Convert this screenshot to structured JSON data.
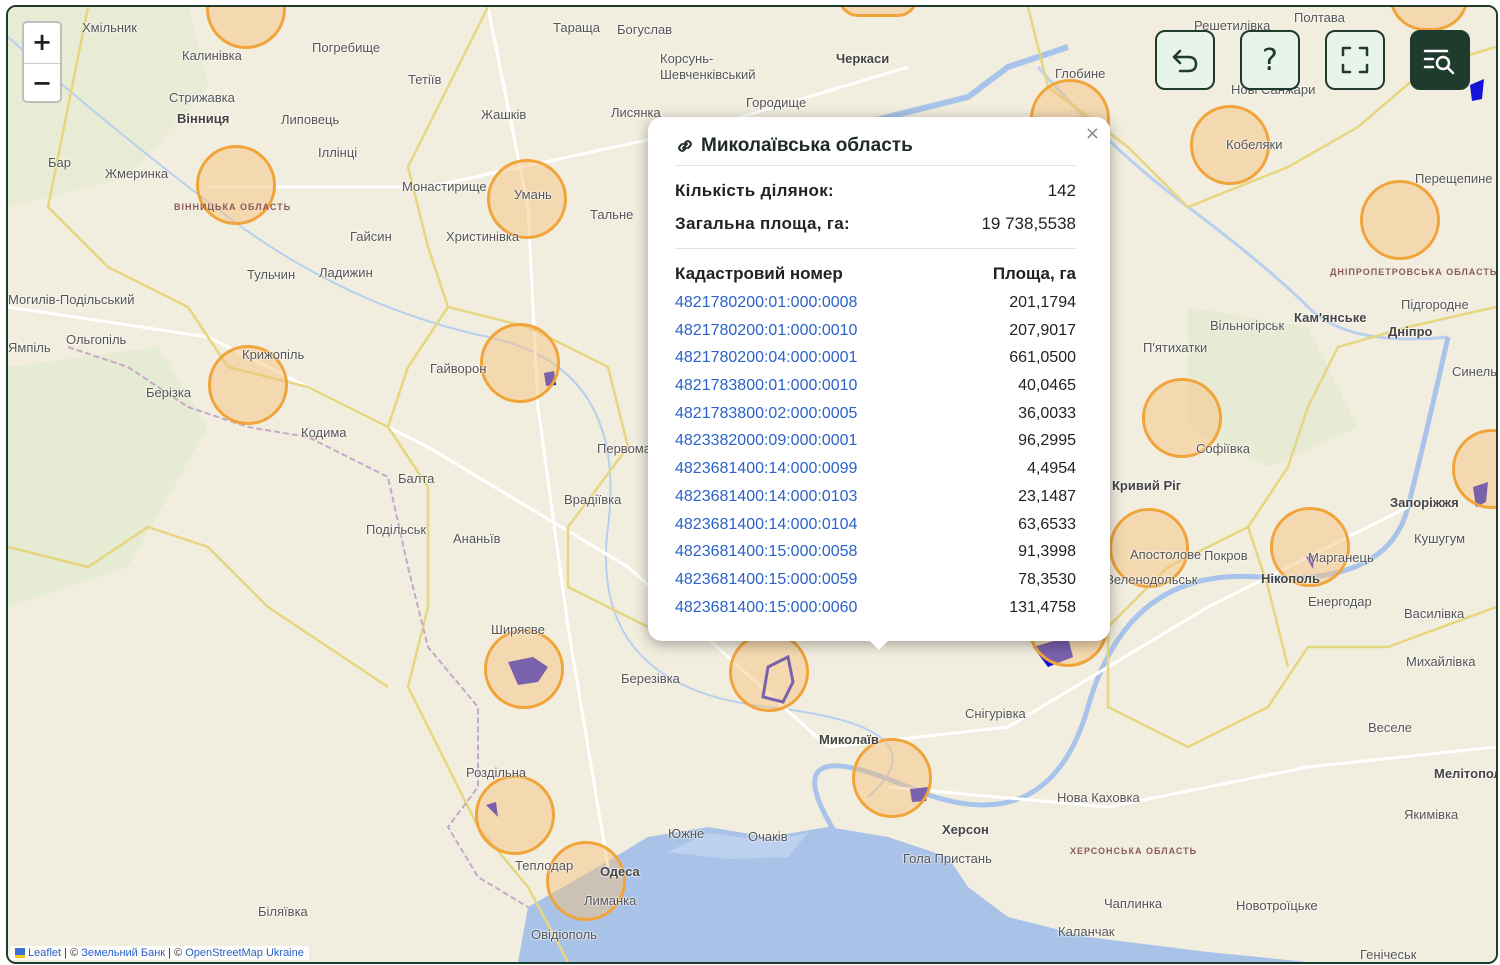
{
  "map": {
    "region_labels": [
      "ВІННИЦЬКА ОБЛАСТЬ",
      "ДНІПРОПЕТРОВСЬКА ОБЛАСТЬ",
      "ХЕРСОНСЬКА ОБЛАСТЬ"
    ],
    "cities": [
      "Хмільник",
      "Калинівка",
      "Погребище",
      "Тараща",
      "Богуслав",
      "Полтава",
      "Решетилівка",
      "Корсунь-Шевченківський",
      "Черкаси",
      "Глобине",
      "Тетіїв",
      "Стрижавка",
      "Вінниця",
      "Липовець",
      "Жашків",
      "Лисянка",
      "Городище",
      "Нові Санжари",
      "Бар",
      "Жмеринка",
      "Іллінці",
      "Кобеляки",
      "Монастирище",
      "Умань",
      "Тальне",
      "Перещепине",
      "Гайсин",
      "Христинівка",
      "Тульчин",
      "Ладижин",
      "Кам'янське",
      "Дніпро",
      "Підгородне",
      "Вільногірськ",
      "П'ятихатки",
      "Крижопіль",
      "Гайворон",
      "Синельникове",
      "Кодима",
      "Первомайськ",
      "Софіївка",
      "Кривий Ріг",
      "Балта",
      "Врадіївка",
      "Запоріжжя",
      "Подільськ",
      "Ананьїв",
      "Апостолове",
      "Покров",
      "Марганець",
      "Кушугум",
      "Зеленодольськ",
      "Нікополь",
      "Енергодар",
      "Василівка",
      "Ширяєве",
      "Березівка",
      "Михайлівка",
      "Снігурівка",
      "Веселе",
      "Миколаїв",
      "Роздільна",
      "Мелітополь",
      "Нова Каховка",
      "Якимівка",
      "Херсон",
      "Южне",
      "Очаків",
      "Гола Пристань",
      "Теплодар",
      "Одеса",
      "Лиманка",
      "Чаплинка",
      "Новотроїцьке",
      "Біляївка",
      "Овідіополь",
      "Каланчак",
      "Генічеськ",
      "Могилів-Подільський",
      "Ольгопіль",
      "Ямпіль",
      "Берізка"
    ]
  },
  "zoom": {
    "in": "+",
    "out": "−"
  },
  "controls": {
    "undo_icon": "undo-icon",
    "help_label": "?",
    "fullscreen_icon": "fullscreen-icon",
    "search_icon": "list-search-icon"
  },
  "popup": {
    "title": "Миколаївська область",
    "close": "×",
    "count_label": "Кількість ділянок:",
    "count_value": "142",
    "area_label": "Загальна площа, га:",
    "area_value": "19 738,5538",
    "col_cadastral": "Кадастровий номер",
    "col_area": "Площа, га",
    "plots": [
      {
        "id": "4821780200:01:000:0008",
        "area": "201,1794"
      },
      {
        "id": "4821780200:01:000:0010",
        "area": "207,9017"
      },
      {
        "id": "4821780200:04:000:0001",
        "area": "661,0500"
      },
      {
        "id": "4821783800:01:000:0010",
        "area": "40,0465"
      },
      {
        "id": "4821783800:02:000:0005",
        "area": "36,0033"
      },
      {
        "id": "4823382000:09:000:0001",
        "area": "96,2995"
      },
      {
        "id": "4823681400:14:000:0099",
        "area": "4,4954"
      },
      {
        "id": "4823681400:14:000:0103",
        "area": "23,1487"
      },
      {
        "id": "4823681400:14:000:0104",
        "area": "63,6533"
      },
      {
        "id": "4823681400:15:000:0058",
        "area": "91,3998"
      },
      {
        "id": "4823681400:15:000:0059",
        "area": "78,3530"
      },
      {
        "id": "4823681400:15:000:0060",
        "area": "131,4758"
      }
    ]
  },
  "attribution": {
    "leaflet": "Leaflet",
    "sep1": " | © ",
    "bank": "Земельний Банк",
    "sep2": " | © ",
    "osm": "OpenStreetMap Ukraine"
  },
  "colors": {
    "cluster_border": "#f0a43a",
    "cluster_fill": "#f7be78",
    "plot_blue": "#1414d8",
    "link": "#2a62c9",
    "dark_green": "#1f3b2e"
  }
}
